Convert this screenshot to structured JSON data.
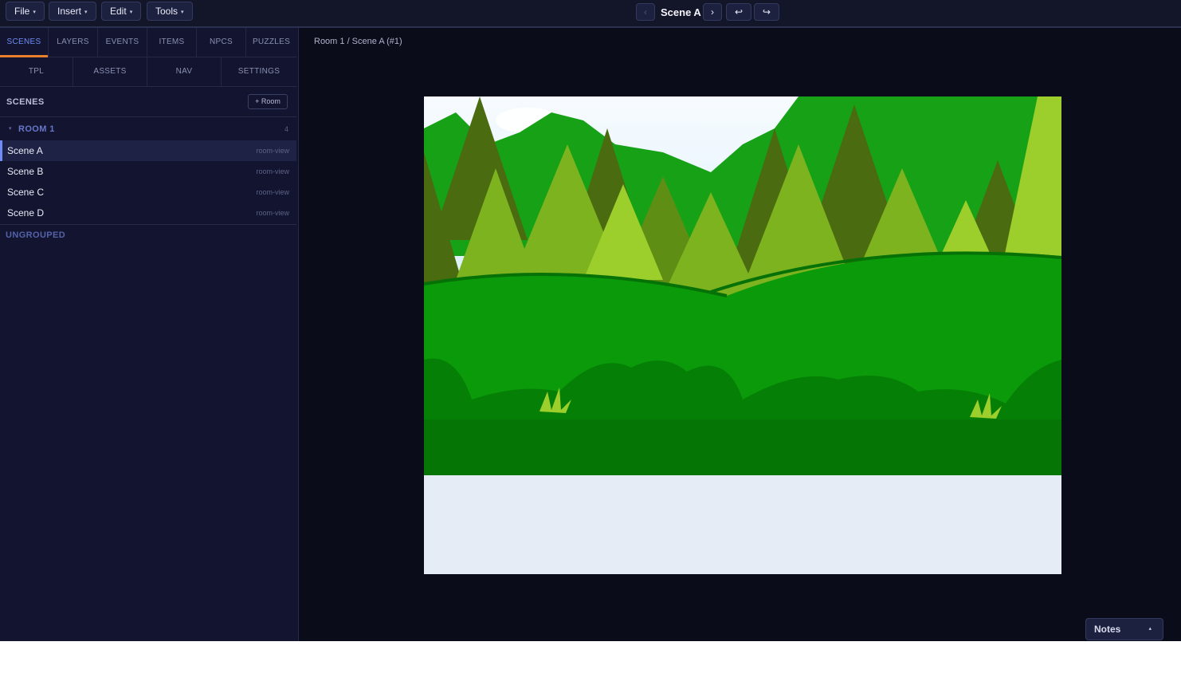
{
  "menu": {
    "file": "File",
    "insert": "Insert",
    "edit": "Edit",
    "tools": "Tools",
    "caret": "▾"
  },
  "scene_nav": {
    "prev": "‹",
    "title": "Scene A",
    "next": "›",
    "undo": "↩",
    "redo": "↪"
  },
  "tabs_primary": [
    "SCENES",
    "LAYERS",
    "EVENTS",
    "ITEMS",
    "NPCS",
    "PUZZLES"
  ],
  "tabs_secondary": [
    "TPL",
    "ASSETS",
    "NAV",
    "SETTINGS"
  ],
  "scenes_panel": {
    "title": "SCENES",
    "add_room": "+ Room",
    "group": {
      "caret": "▾",
      "title": "ROOM 1",
      "count": "4"
    },
    "items": [
      {
        "name": "Scene A",
        "tag": "room-view"
      },
      {
        "name": "Scene B",
        "tag": "room-view"
      },
      {
        "name": "Scene C",
        "tag": "room-view"
      },
      {
        "name": "Scene D",
        "tag": "room-view"
      }
    ],
    "ungrouped": "UNGROUPED"
  },
  "breadcrumb": "Room 1 / Scene A (#1)",
  "notes": {
    "label": "Notes",
    "caret": "▴"
  },
  "colors": {
    "accent": "#6f8ef5",
    "tab_underline": "#e8802d",
    "app_bg": "#0b0c1a",
    "sidebar_bg": "#121430"
  }
}
